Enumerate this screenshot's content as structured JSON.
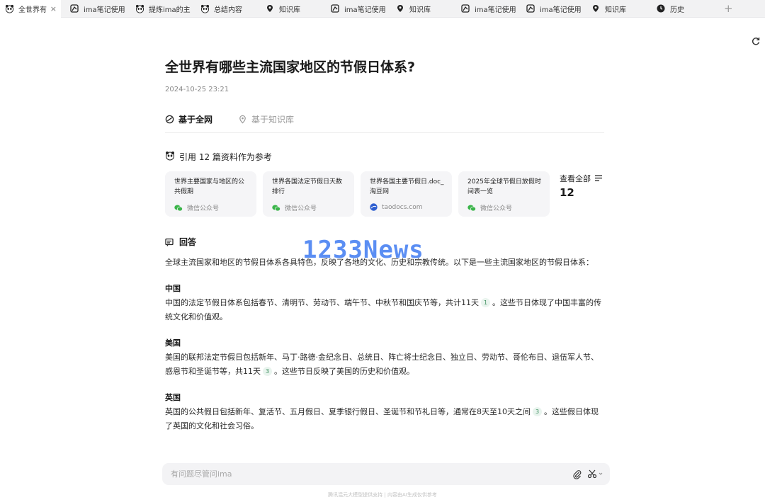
{
  "tabs": [
    {
      "label": "全世界有",
      "icon": "panda-icon",
      "active": true
    },
    {
      "label": "ima笔记使用",
      "icon": "ima-note-icon"
    },
    {
      "label": "提炼ima的主",
      "icon": "panda-icon"
    },
    {
      "label": "总结内容",
      "icon": "panda-icon"
    },
    {
      "label": "知识库",
      "icon": "knowledge-pin-icon"
    },
    {
      "label": "ima笔记使用",
      "icon": "ima-note-icon"
    },
    {
      "label": "知识库",
      "icon": "knowledge-pin-icon"
    },
    {
      "label": "ima笔记使用",
      "icon": "ima-note-icon"
    },
    {
      "label": "ima笔记使用",
      "icon": "ima-note-icon"
    },
    {
      "label": "知识库",
      "icon": "knowledge-pin-icon"
    },
    {
      "label": "历史",
      "icon": "history-clock-icon"
    }
  ],
  "new_tab_symbol": "+",
  "close_symbol": "×",
  "page": {
    "title": "全世界有哪些主流国家地区的节假日体系?",
    "date": "2024-10-25 23:21"
  },
  "source_tabs": {
    "web": "基于全网",
    "kb": "基于知识库"
  },
  "references": {
    "heading": "引用 12 篇资料作为参考",
    "cards": [
      {
        "title": "世界主要国家与地区的公共假期",
        "source": "微信公众号",
        "source_icon": "wechat-icon"
      },
      {
        "title": "世界各国法定节假日天数排行",
        "source": "微信公众号",
        "source_icon": "wechat-icon"
      },
      {
        "title": "世界各国主要节假日.doc_淘豆网",
        "source": "taodocs.com",
        "source_icon": "taodocs-icon"
      },
      {
        "title": "2025年全球节假日放假时间表一览",
        "source": "微信公众号",
        "source_icon": "wechat-icon"
      }
    ],
    "view_all_label": "查看全部",
    "view_all_count": "12"
  },
  "answer": {
    "heading": "回答",
    "intro": "全球主流国家和地区的节假日体系各具特色，反映了各地的文化、历史和宗教传统。以下是一些主流国家地区的节假日体系：",
    "sections": [
      {
        "name": "中国",
        "text_before": "中国的法定节假日体系包括春节、清明节、劳动节、端午节、中秋节和国庆节等，共计11天",
        "cite": "1",
        "text_after": "。这些节日体现了中国丰富的传统文化和价值观。"
      },
      {
        "name": "美国",
        "text_before": "美国的联邦法定节假日包括新年、马丁·路德·金纪念日、总统日、阵亡将士纪念日、独立日、劳动节、哥伦布日、退伍军人节、感恩节和圣诞节等，共11天",
        "cite": "3",
        "text_after": "。这些节日反映了美国的历史和价值观。"
      },
      {
        "name": "英国",
        "text_before": "英国的公共假日包括新年、复活节、五月假日、夏季银行假日、圣诞节和节礼日等，通常在8天至10天之间",
        "cite": "3",
        "text_after": "。这些假日体现了英国的文化和社会习俗。"
      }
    ]
  },
  "watermark": "1233News",
  "input": {
    "placeholder": "有问题尽管问ima"
  },
  "footer": "腾讯混元大模型提供支持 | 内容由AI生成仅供参考",
  "colors": {
    "accent_green": "#3d8f5f",
    "watermark_blue": "#3f7bf2",
    "wechat_green": "#3bb54a",
    "taodocs_blue": "#2f5fd0"
  }
}
